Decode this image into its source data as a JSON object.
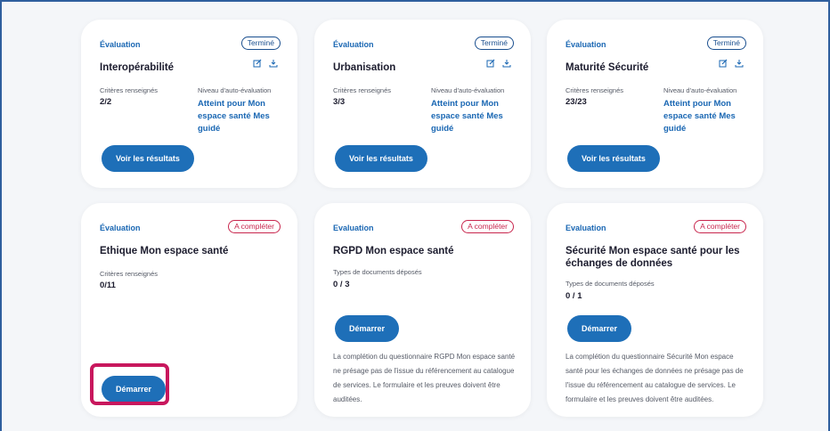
{
  "cards": [
    {
      "eval_label": "Évaluation",
      "status": "Terminé",
      "title": "Interopérabilité",
      "criteria_label": "Critères renseignés",
      "criteria_value": "2/2",
      "level_label": "Niveau d'auto-évaluation",
      "level_value": "Atteint pour Mon espace santé Mes guidé",
      "button": "Voir les résultats"
    },
    {
      "eval_label": "Évaluation",
      "status": "Terminé",
      "title": "Urbanisation",
      "criteria_label": "Critères renseignés",
      "criteria_value": "3/3",
      "level_label": "Niveau d'auto-évaluation",
      "level_value": "Atteint pour Mon espace santé Mes guidé",
      "button": "Voir les résultats"
    },
    {
      "eval_label": "Évaluation",
      "status": "Terminé",
      "title": "Maturité Sécurité",
      "criteria_label": "Critères renseignés",
      "criteria_value": "23/23",
      "level_label": "Niveau d'auto-évaluation",
      "level_value": "Atteint pour Mon espace santé Mes guidé",
      "button": "Voir les résultats"
    },
    {
      "eval_label": "Évaluation",
      "status": "A compléter",
      "title": "Ethique Mon espace santé",
      "criteria_label": "Critères renseignés",
      "criteria_value": "0/11",
      "button": "Démarrer"
    },
    {
      "eval_label": "Evaluation",
      "status": "A compléter",
      "title": "RGPD Mon espace santé",
      "docs_label": "Types de documents déposés",
      "docs_value": "0 / 3",
      "button": "Démarrer",
      "note": "La complétion du questionnaire RGPD Mon espace santé ne présage pas de l'issue du référencement au catalogue de services. Le formulaire et les preuves doivent être auditées."
    },
    {
      "eval_label": "Evaluation",
      "status": "A compléter",
      "title": "Sécurité Mon espace santé pour les échanges de données",
      "docs_label": "Types de documents déposés",
      "docs_value": "0 / 1",
      "button": "Démarrer",
      "note": "La complétion du questionnaire Sécurité Mon espace santé pour les échanges de données ne présage pas de l'issue du référencement au catalogue de services. Le formulaire et les preuves doivent être auditées."
    }
  ],
  "colors": {
    "primary": "#1e6fb8",
    "done_badge": "#1a4f8f",
    "todo_badge": "#c8264d",
    "highlight": "#c8175d",
    "background": "#f4f6f9"
  },
  "icons": [
    "edit-icon",
    "download-icon"
  ]
}
